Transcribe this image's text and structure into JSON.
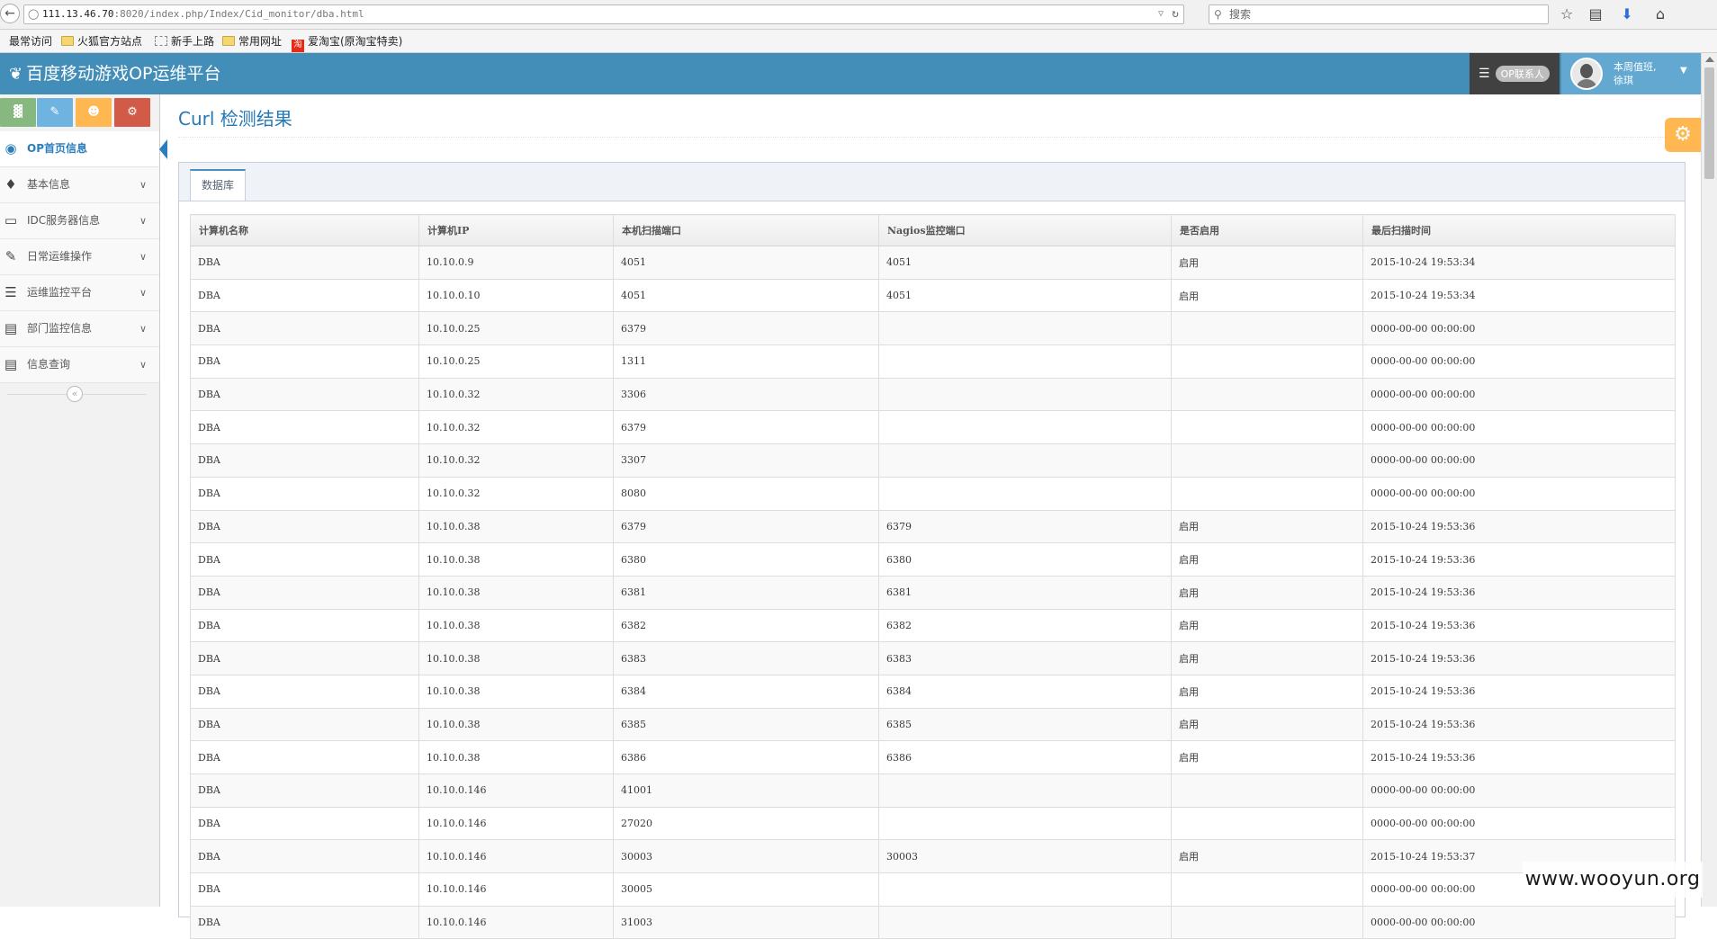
{
  "browser": {
    "url_host": "111.13.46.70",
    "url_path": ":8020/index.php/Index/Cid_monitor/dba.html",
    "search_placeholder": "搜索"
  },
  "bookmarks": [
    "最常访问",
    "火狐官方站点",
    "新手上路",
    "常用网址",
    "爱淘宝(原淘宝特卖)"
  ],
  "header": {
    "title": "百度移动游戏OP运维平台",
    "contact_label": "OP联系人",
    "welcome": "本周值班,",
    "user_name": "徐琪"
  },
  "sidebar": {
    "items": [
      {
        "label": "OP首页信息",
        "icon": "dashboard-icon",
        "active": true
      },
      {
        "label": "基本信息",
        "icon": "tag-icon"
      },
      {
        "label": "IDC服务器信息",
        "icon": "desktop-icon"
      },
      {
        "label": "日常运维操作",
        "icon": "edit-icon"
      },
      {
        "label": "运维监控平台",
        "icon": "list-icon"
      },
      {
        "label": "部门监控信息",
        "icon": "list-alt-icon"
      },
      {
        "label": "信息查询",
        "icon": "list-alt-icon"
      }
    ]
  },
  "page": {
    "title": "Curl 检测结果",
    "tab_label": "数据库"
  },
  "table": {
    "headers": [
      "计算机名称",
      "计算机IP",
      "本机扫描端口",
      "Nagios监控端口",
      "是否启用",
      "最后扫描时间"
    ],
    "rows": [
      [
        "DBA",
        "10.10.0.9",
        "4051",
        "4051",
        "启用",
        "2015-10-24 19:53:34"
      ],
      [
        "DBA",
        "10.10.0.10",
        "4051",
        "4051",
        "启用",
        "2015-10-24 19:53:34"
      ],
      [
        "DBA",
        "10.10.0.25",
        "6379",
        "",
        "",
        "0000-00-00 00:00:00"
      ],
      [
        "DBA",
        "10.10.0.25",
        "1311",
        "",
        "",
        "0000-00-00 00:00:00"
      ],
      [
        "DBA",
        "10.10.0.32",
        "3306",
        "",
        "",
        "0000-00-00 00:00:00"
      ],
      [
        "DBA",
        "10.10.0.32",
        "6379",
        "",
        "",
        "0000-00-00 00:00:00"
      ],
      [
        "DBA",
        "10.10.0.32",
        "3307",
        "",
        "",
        "0000-00-00 00:00:00"
      ],
      [
        "DBA",
        "10.10.0.32",
        "8080",
        "",
        "",
        "0000-00-00 00:00:00"
      ],
      [
        "DBA",
        "10.10.0.38",
        "6379",
        "6379",
        "启用",
        "2015-10-24 19:53:36"
      ],
      [
        "DBA",
        "10.10.0.38",
        "6380",
        "6380",
        "启用",
        "2015-10-24 19:53:36"
      ],
      [
        "DBA",
        "10.10.0.38",
        "6381",
        "6381",
        "启用",
        "2015-10-24 19:53:36"
      ],
      [
        "DBA",
        "10.10.0.38",
        "6382",
        "6382",
        "启用",
        "2015-10-24 19:53:36"
      ],
      [
        "DBA",
        "10.10.0.38",
        "6383",
        "6383",
        "启用",
        "2015-10-24 19:53:36"
      ],
      [
        "DBA",
        "10.10.0.38",
        "6384",
        "6384",
        "启用",
        "2015-10-24 19:53:36"
      ],
      [
        "DBA",
        "10.10.0.38",
        "6385",
        "6385",
        "启用",
        "2015-10-24 19:53:36"
      ],
      [
        "DBA",
        "10.10.0.38",
        "6386",
        "6386",
        "启用",
        "2015-10-24 19:53:36"
      ],
      [
        "DBA",
        "10.10.0.146",
        "41001",
        "",
        "",
        "0000-00-00 00:00:00"
      ],
      [
        "DBA",
        "10.10.0.146",
        "27020",
        "",
        "",
        "0000-00-00 00:00:00"
      ],
      [
        "DBA",
        "10.10.0.146",
        "30003",
        "30003",
        "启用",
        "2015-10-24 19:53:37"
      ],
      [
        "DBA",
        "10.10.0.146",
        "30005",
        "",
        "",
        "0000-00-00 00:00:00"
      ],
      [
        "DBA",
        "10.10.0.146",
        "31003",
        "",
        "",
        "0000-00-00 00:00:00"
      ]
    ]
  },
  "watermark": "www.wooyun.org",
  "colors": {
    "header_bg": "#438eb9",
    "active_nav": "#2b7dbc",
    "settings_btn": "#ffb752",
    "shortcut_green": "#87b87f",
    "shortcut_blue": "#6fb3e0",
    "shortcut_orange": "#ffb752",
    "shortcut_red": "#d15b47"
  }
}
